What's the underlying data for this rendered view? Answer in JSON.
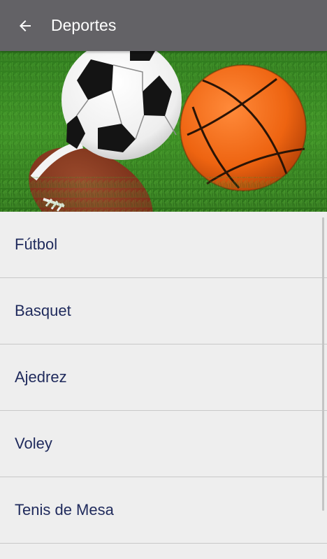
{
  "appbar": {
    "title": "Deportes",
    "back_icon": "arrow-back-icon",
    "background": "#636266"
  },
  "hero": {
    "image": "sports-balls-on-grass",
    "balls": [
      "soccer-ball",
      "basketball",
      "american-football"
    ]
  },
  "list": {
    "items": [
      {
        "label": "Fútbol"
      },
      {
        "label": "Basquet"
      },
      {
        "label": "Ajedrez"
      },
      {
        "label": "Voley"
      },
      {
        "label": "Tenis de Mesa"
      }
    ],
    "text_color": "#1f2a5c"
  }
}
